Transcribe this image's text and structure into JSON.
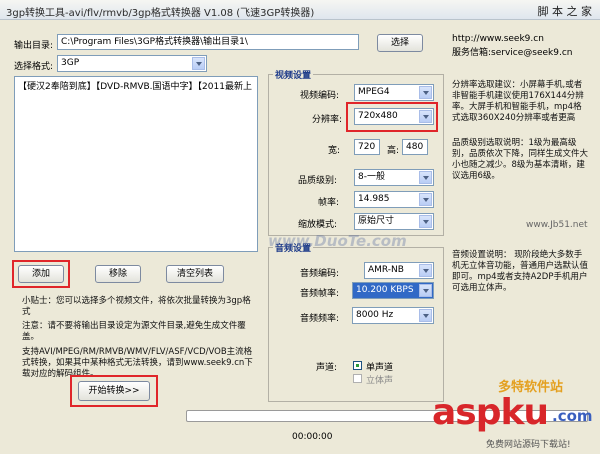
{
  "window": {
    "title": "3gp转换工具-avi/flv/rmvb/3gp格式转换器 V1.08 (飞速3GP转换器)"
  },
  "watermark_top": "脚 本 之 家",
  "output": {
    "label": "输出目录:",
    "path": "C:\\Program Files\\3GP格式转换器\\输出目录1\\",
    "choose_btn": "选择",
    "site": "http://www.seek9.cn",
    "service": "服务信箱:service@seek9.cn"
  },
  "format": {
    "label": "选择格式:",
    "value": "3GP"
  },
  "file_list": "【硬汉2奉陪到底】【DVD-RMVB.国语中字】【2011最新上",
  "buttons": {
    "add": "添加",
    "remove": "移除",
    "clear": "清空列表",
    "start": "开始转换>>"
  },
  "tips": {
    "t1": "小贴士：您可以选择多个视频文件，将依次批量转换为3gp格式",
    "t2": "注意：请不要将输出目录设定为源文件目录,避免生成文件覆盖。",
    "t3": "支持AVI/MPEG/RM/RMVB/WMV/FLV/ASF/VCD/VOB主流格式转换，如果其中某种格式无法转换，请到www.seek9.cn下载对应的解码组件。"
  },
  "video": {
    "group": "视频设置",
    "codec_label": "视频编码:",
    "codec": "MPEG4",
    "res_label": "分辨率:",
    "res": "720x480",
    "width_label": "宽:",
    "width": "720",
    "height_label": "高:",
    "height": "480",
    "quality_label": "品质级别:",
    "quality": "8-一般",
    "fps_label": "帧率:",
    "fps": "14.985",
    "scale_label": "缩放模式:",
    "scale": "原始尺寸"
  },
  "audio": {
    "group": "音频设置",
    "codec_label": "音频编码:",
    "codec": "AMR-NB",
    "bitrate_label": "音频帧率:",
    "bitrate": "10.200 KBPS",
    "freq_label": "音频频率:",
    "freq": "8000 Hz",
    "channel_label": "声道:",
    "mono": "单声道",
    "stereo": "立体声"
  },
  "hints": {
    "res": "分辨率选取建议：小屏幕手机,或者非智能手机建议使用176X144分辨率。大屏手机和智能手机，mp4格式选取360X240分辨率或者更高",
    "quality": "品质级别选取说明：1级为最高级别，品质依次下降，同样生成文件大小也随之减少。8级为基本清晰，建议选用6级。",
    "audio": "音频设置说明：   现阶段绝大多数手机无立体音功能，普通用户选默认值即可。mp4或者支持A2DP手机用户可选用立体声。"
  },
  "time": "00:00:00",
  "watermark_mid": "www.DuoTe.com",
  "watermark_right": "www.Jb51.net",
  "watermark_brand": {
    "cn": "多特软件站",
    "big": "aspku",
    "dot": ".com",
    "sub": "免费网站源码下载站!"
  },
  "colors": {
    "red_box": "#e0262a",
    "highlight": "#3169c6",
    "group_title": "#1f3c8a"
  }
}
